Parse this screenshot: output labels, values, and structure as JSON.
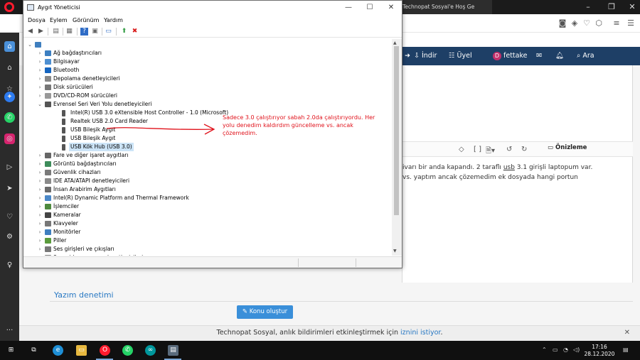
{
  "browser": {
    "tab_title": "Technopat Sosyal'e Hoş Ge",
    "nav": {
      "download": "İndir",
      "members": "Üyel",
      "user_initial": "D",
      "username": "fettake",
      "search": "Ara"
    },
    "editor": {
      "preview": "Önizleme",
      "post_line1_pre": "ivarı bir anda kapandı. 2 taraflı ",
      "post_line1_link": "usb",
      "post_line1_post": " 3.1 girişli laptopum var.",
      "post_line2": "vs. yaptım ancak çözemedim ek dosyada hangi portun"
    },
    "spell_check": "Yazım denetimi",
    "create_topic": "Konu oluştur",
    "notification": {
      "text": "Technopat Sosyal, anlık bildirimleri etkinleştirmek için ",
      "link": "iznini istiyor",
      "suffix": "."
    }
  },
  "device_manager": {
    "title": "Aygıt Yöneticisi",
    "menu": [
      "Dosya",
      "Eylem",
      "Görünüm",
      "Yardım"
    ],
    "tree": [
      {
        "label": "Ağ bağdaştırıcıları",
        "icon": "network-icon",
        "color": "#3c7fc1",
        "level": 1,
        "expander": "›"
      },
      {
        "label": "Bilgisayar",
        "icon": "computer-icon",
        "color": "#4d8fd1",
        "level": 1,
        "expander": "›"
      },
      {
        "label": "Bluetooth",
        "icon": "bluetooth-icon",
        "color": "#1565c0",
        "level": 1,
        "expander": "›"
      },
      {
        "label": "Depolama denetleyicileri",
        "icon": "storage-icon",
        "color": "#888888",
        "level": 1,
        "expander": "›"
      },
      {
        "label": "Disk sürücüleri",
        "icon": "disk-icon",
        "color": "#777777",
        "level": 1,
        "expander": "›"
      },
      {
        "label": "DVD/CD-ROM sürücüleri",
        "icon": "dvd-icon",
        "color": "#999999",
        "level": 1,
        "expander": "›"
      },
      {
        "label": "Evrensel Seri Veri Yolu denetleyicileri",
        "icon": "usb-icon",
        "color": "#555555",
        "level": 1,
        "expander": "⌄"
      },
      {
        "label": "Intel(R) USB 3.0 eXtensible Host Controller - 1.0 (Microsoft)",
        "icon": "usb-device-icon",
        "color": "#555555",
        "level": 2,
        "expander": ""
      },
      {
        "label": "Realtek USB 2.0 Card Reader",
        "icon": "usb-device-icon",
        "color": "#555555",
        "level": 2,
        "expander": ""
      },
      {
        "label": "USB Bileşik Aygıt",
        "icon": "usb-device-icon",
        "color": "#555555",
        "level": 2,
        "expander": ""
      },
      {
        "label": "USB Bileşik Aygıt",
        "icon": "usb-device-icon",
        "color": "#555555",
        "level": 2,
        "expander": ""
      },
      {
        "label": "USB Kök Hub (USB 3.0)",
        "icon": "usb-device-icon",
        "color": "#555555",
        "level": 2,
        "expander": "",
        "selected": true
      },
      {
        "label": "Fare ve diğer işaret aygıtları",
        "icon": "mouse-icon",
        "color": "#666666",
        "level": 1,
        "expander": "›"
      },
      {
        "label": "Görüntü bağdaştırıcıları",
        "icon": "display-adapter-icon",
        "color": "#3d8c5a",
        "level": 1,
        "expander": "›"
      },
      {
        "label": "Güvenlik cihazları",
        "icon": "security-device-icon",
        "color": "#7a7a7a",
        "level": 1,
        "expander": "›"
      },
      {
        "label": "IDE ATA/ATAPI denetleyicileri",
        "icon": "ide-icon",
        "color": "#8a8a8a",
        "level": 1,
        "expander": "›"
      },
      {
        "label": "İnsan Arabirim Aygıtları",
        "icon": "hid-icon",
        "color": "#6b6b6b",
        "level": 1,
        "expander": "›"
      },
      {
        "label": "Intel(R) Dynamic Platform and Thermal Framework",
        "icon": "platform-icon",
        "color": "#4b88c8",
        "level": 1,
        "expander": "›"
      },
      {
        "label": "İşlemciler",
        "icon": "processor-icon",
        "color": "#4e8a3e",
        "level": 1,
        "expander": "›"
      },
      {
        "label": "Kameralar",
        "icon": "camera-icon",
        "color": "#444444",
        "level": 1,
        "expander": "›"
      },
      {
        "label": "Klavyeler",
        "icon": "keyboard-icon",
        "color": "#777777",
        "level": 1,
        "expander": "›"
      },
      {
        "label": "Monitörler",
        "icon": "monitor-icon",
        "color": "#3f7fbf",
        "level": 1,
        "expander": "›"
      },
      {
        "label": "Piller",
        "icon": "battery-icon",
        "color": "#5a9b3c",
        "level": 1,
        "expander": "›"
      },
      {
        "label": "Ses girişleri ve çıkışları",
        "icon": "audio-io-icon",
        "color": "#777777",
        "level": 1,
        "expander": "›"
      },
      {
        "label": "Ses, video ve oyun denetleyicileri",
        "icon": "sound-video-icon",
        "color": "#777777",
        "level": 1,
        "expander": "›"
      }
    ]
  },
  "annotation": "Sadece 3.0 çalıştırıyor sabah 2.0da çalıştırıyordu. Her yolu denedim kaldırdım güncelleme vs. ancak çözemedim.",
  "annotation_color": "#e0121b",
  "taskbar": {
    "time": "17:16",
    "date": "28.12.2020"
  }
}
